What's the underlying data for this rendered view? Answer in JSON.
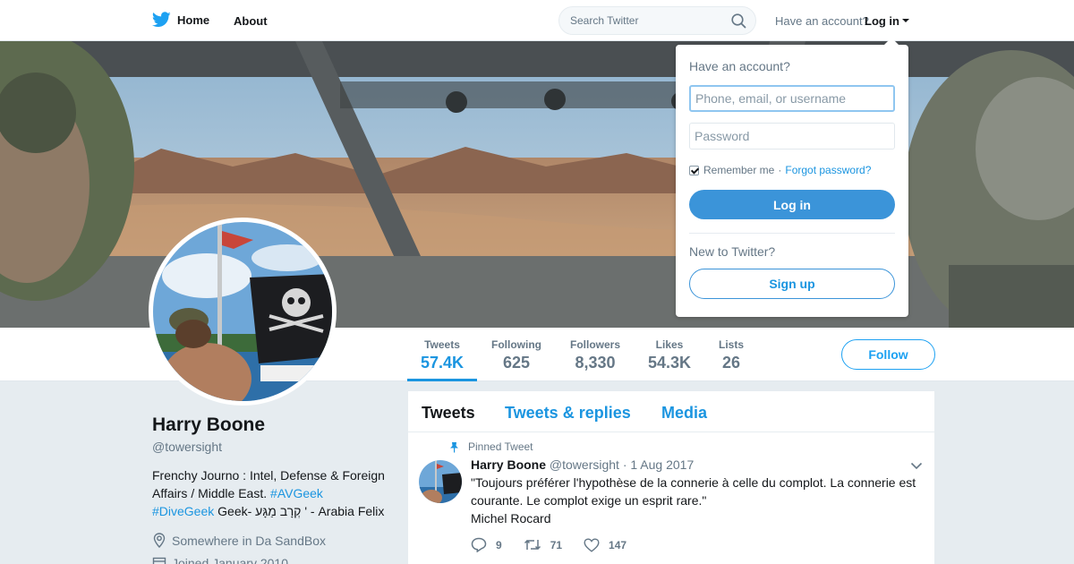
{
  "nav": {
    "home_label": "Home",
    "about_label": "About",
    "search_placeholder": "Search Twitter",
    "have_account": "Have an account?",
    "login_label": "Log in"
  },
  "login_dropdown": {
    "title": "Have an account?",
    "username_placeholder": "Phone, email, or username",
    "password_placeholder": "Password",
    "remember_me": "Remember me",
    "separator": "·",
    "forgot_password": "Forgot password?",
    "login_button": "Log in",
    "new_to_twitter": "New to Twitter?",
    "signup_button": "Sign up",
    "remember_checked": true
  },
  "profile_nav": {
    "stats": [
      {
        "label": "Tweets",
        "value": "57.4K",
        "active": true
      },
      {
        "label": "Following",
        "value": "625"
      },
      {
        "label": "Followers",
        "value": "8,330"
      },
      {
        "label": "Likes",
        "value": "54.3K"
      },
      {
        "label": "Lists",
        "value": "26"
      }
    ],
    "follow_button": "Follow"
  },
  "profile": {
    "name": "Harry Boone",
    "handle": "@towersight",
    "bio_part1": "Frenchy Journo : Intel, Defense & Foreign Affairs / Middle East.",
    "bio_hashtag1": "#AVGeek",
    "bio_hashtag2": "#DiveGeek",
    "bio_part2": "Geek- קְרָב מַגָּע ' - Arabia Felix",
    "location": "Somewhere in Da SandBox",
    "joined": "Joined January 2010"
  },
  "timeline": {
    "tabs": [
      "Tweets",
      "Tweets & replies",
      "Media"
    ],
    "active_tab": "Tweets",
    "pinned_label": "Pinned Tweet",
    "tweet": {
      "name": "Harry Boone",
      "handle": "@towersight",
      "separator": "·",
      "date": "1 Aug 2017",
      "text_line1": "\"Toujours préférer l'hypothèse de la connerie à celle du complot. La connerie est courante. Le complot exige un esprit rare.\"",
      "text_line2": "Michel Rocard",
      "replies": "9",
      "retweets": "71",
      "likes": "147"
    }
  },
  "colors": {
    "accent": "#1da1f2",
    "link": "#1b95e0",
    "login_button": "#3b94d9",
    "muted": "#657786",
    "page_bg": "#e6ecf0"
  }
}
